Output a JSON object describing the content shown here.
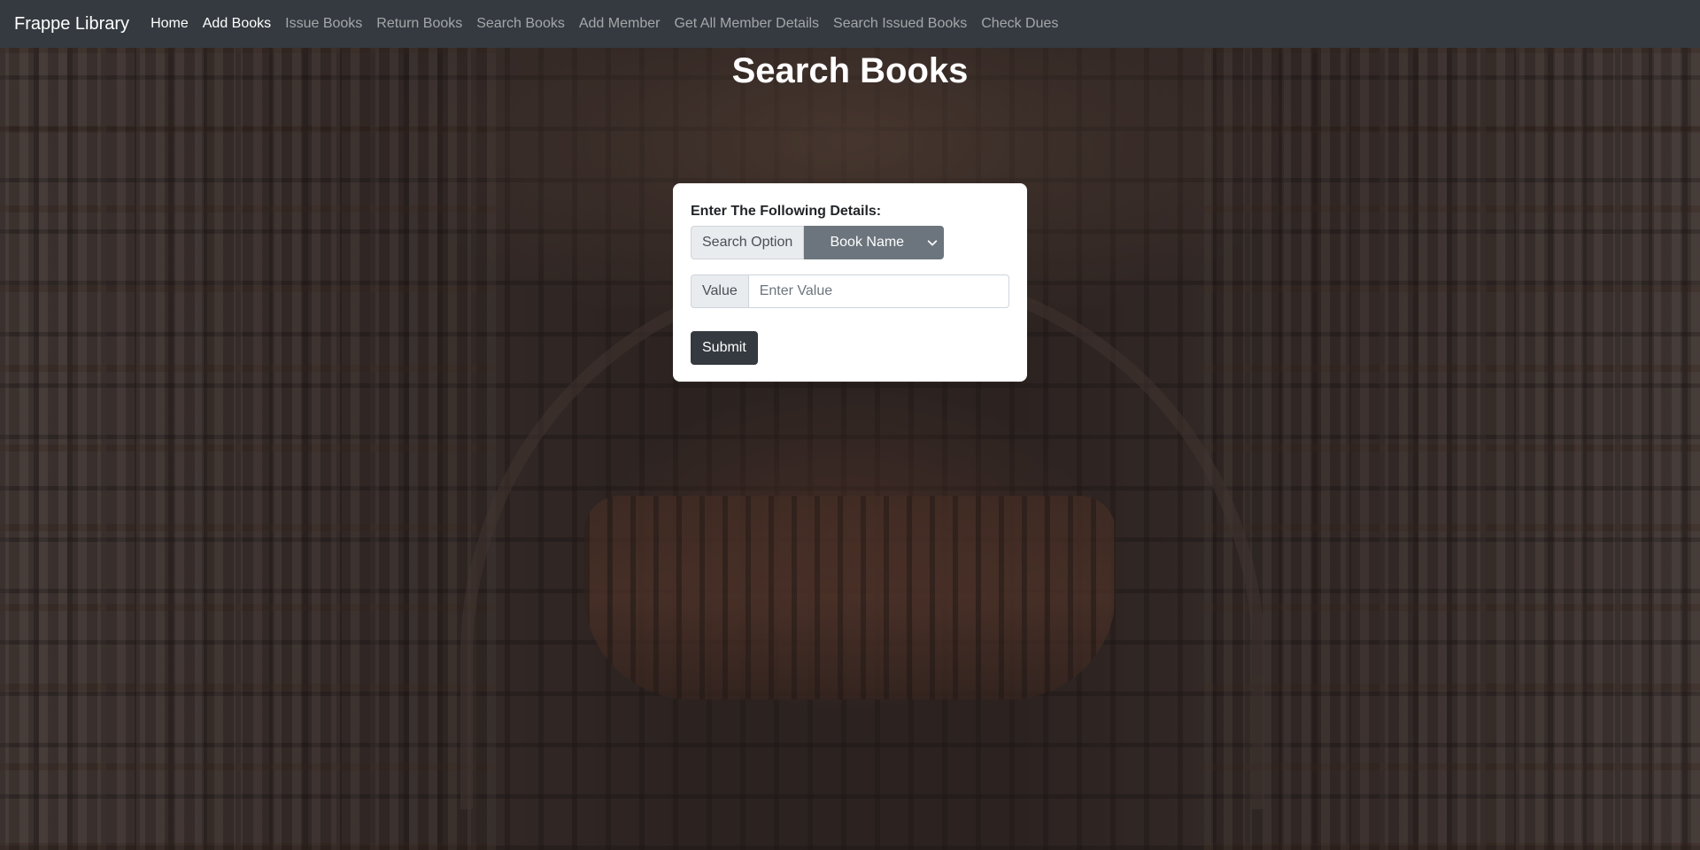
{
  "navbar": {
    "brand": "Frappe Library",
    "links": [
      {
        "label": "Home",
        "active": true
      },
      {
        "label": "Add Books",
        "active": true
      },
      {
        "label": "Issue Books",
        "active": false
      },
      {
        "label": "Return Books",
        "active": false
      },
      {
        "label": "Search Books",
        "active": false
      },
      {
        "label": "Add Member",
        "active": false
      },
      {
        "label": "Get All Member Details",
        "active": false
      },
      {
        "label": "Search Issued Books",
        "active": false
      },
      {
        "label": "Check Dues",
        "active": false
      }
    ]
  },
  "page": {
    "title": "Search Books"
  },
  "form": {
    "heading": "Enter The Following Details:",
    "search_option_label": "Search Option",
    "search_option_value": "Book Name",
    "value_label": "Value",
    "value_placeholder": "Enter Value",
    "value": "",
    "submit_label": "Submit"
  },
  "colors": {
    "navbar_bg": "#343a40",
    "select_bg": "#6c757d",
    "submit_bg": "#343a40"
  },
  "icons": {
    "select_chevron": "chevron-down-icon"
  }
}
